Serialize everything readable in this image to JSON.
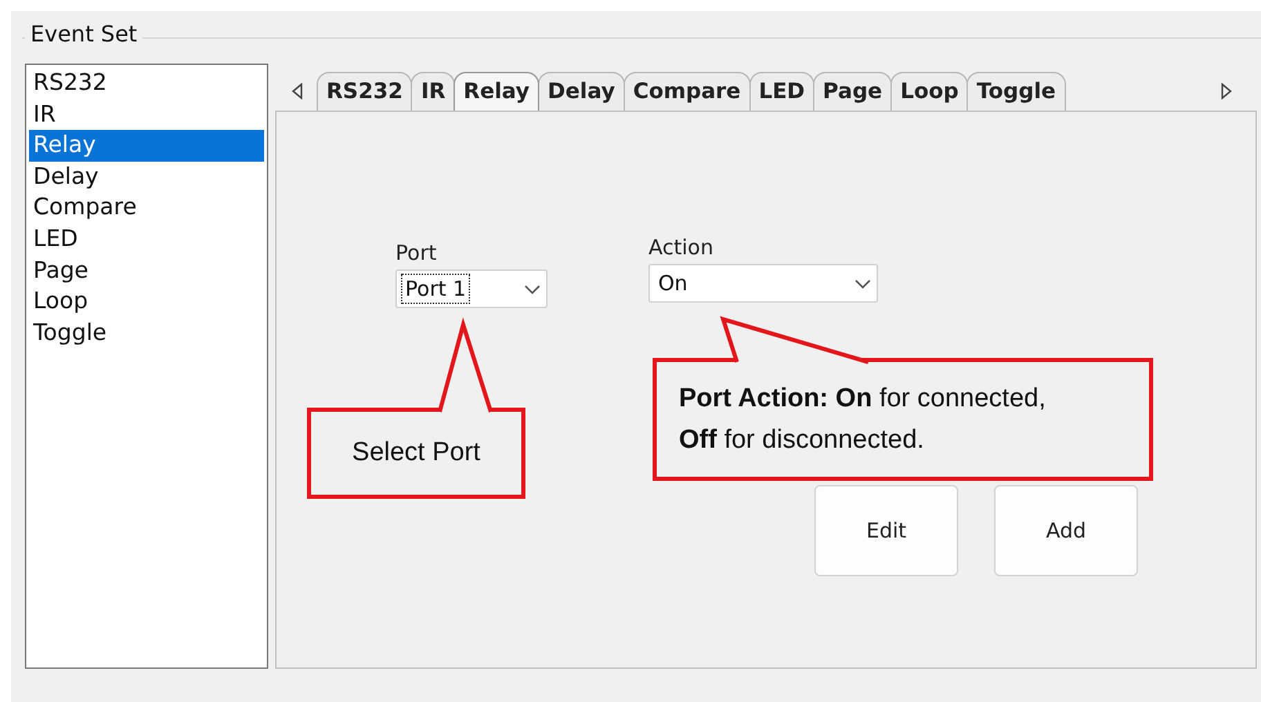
{
  "group": {
    "title": "Event Set"
  },
  "event_list": [
    {
      "label": "RS232",
      "selected": false
    },
    {
      "label": "IR",
      "selected": false
    },
    {
      "label": "Relay",
      "selected": true
    },
    {
      "label": "Delay",
      "selected": false
    },
    {
      "label": "Compare",
      "selected": false
    },
    {
      "label": "LED",
      "selected": false
    },
    {
      "label": "Page",
      "selected": false
    },
    {
      "label": "Loop",
      "selected": false
    },
    {
      "label": "Toggle",
      "selected": false
    }
  ],
  "tabs": [
    {
      "label": "RS232",
      "selected": false
    },
    {
      "label": "IR",
      "selected": false
    },
    {
      "label": "Relay",
      "selected": true
    },
    {
      "label": "Delay",
      "selected": false
    },
    {
      "label": "Compare",
      "selected": false
    },
    {
      "label": "LED",
      "selected": false
    },
    {
      "label": "Page",
      "selected": false
    },
    {
      "label": "Loop",
      "selected": false
    },
    {
      "label": "Toggle",
      "selected": false
    }
  ],
  "port": {
    "label": "Port",
    "value": "Port 1",
    "focused": true
  },
  "action": {
    "label": "Action",
    "value": "On",
    "focused": false
  },
  "buttons": [
    "Edit",
    "Add"
  ],
  "callouts": [
    {
      "lines": [
        "Select Port"
      ]
    },
    {
      "lines": [
        "**Port Action: On** for connected,",
        "**Off** for disconnected."
      ]
    }
  ]
}
